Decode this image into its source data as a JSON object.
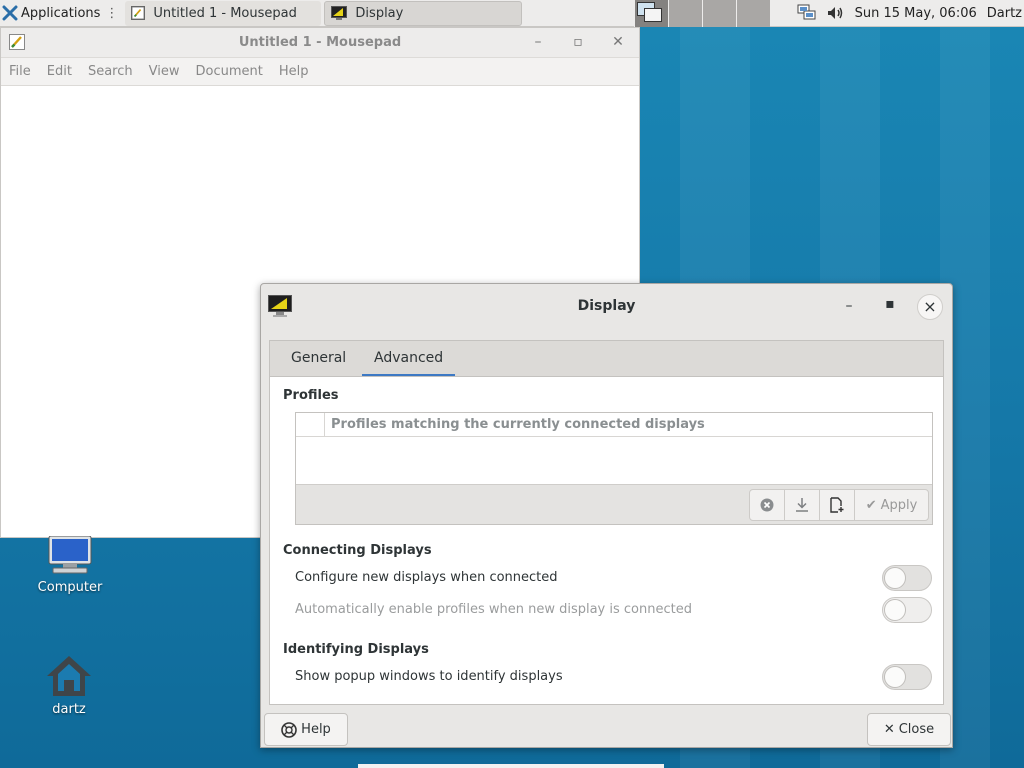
{
  "panel": {
    "applications_label": "Applications",
    "tasks": [
      {
        "label": "Untitled 1 - Mousepad",
        "icon": "mousepad-icon"
      },
      {
        "label": "Display",
        "icon": "display-icon"
      }
    ],
    "clock": "Sun 15 May, 06:06",
    "user": "Dartz",
    "tray_icons": [
      "network-icon",
      "volume-icon"
    ]
  },
  "mousepad": {
    "title": "Untitled 1 - Mousepad",
    "menu": [
      "File",
      "Edit",
      "Search",
      "View",
      "Document",
      "Help"
    ]
  },
  "desktop": {
    "icons": [
      {
        "label": "Computer",
        "icon": "computer-icon"
      },
      {
        "label": "dartz",
        "icon": "home-folder-icon"
      }
    ]
  },
  "dialog": {
    "title": "Display",
    "tabs": [
      "General",
      "Advanced"
    ],
    "active_tab": "Advanced",
    "profiles": {
      "heading": "Profiles",
      "column_header": "Profiles matching the currently connected displays",
      "apply_label": "Apply"
    },
    "connecting": {
      "heading": "Connecting Displays",
      "options": [
        {
          "label": "Configure new displays when connected",
          "enabled": true,
          "on": false
        },
        {
          "label": "Automatically enable profiles when new display is connected",
          "enabled": false,
          "on": false
        }
      ]
    },
    "identifying": {
      "heading": "Identifying Displays",
      "options": [
        {
          "label": "Show popup windows to identify displays",
          "enabled": true,
          "on": false
        }
      ]
    },
    "help_label": "Help",
    "close_label": "Close"
  },
  "colors": {
    "desktop_bg": "#1578a8",
    "tab_accent": "#3d79c4",
    "panel_bg": "#edeceb"
  }
}
